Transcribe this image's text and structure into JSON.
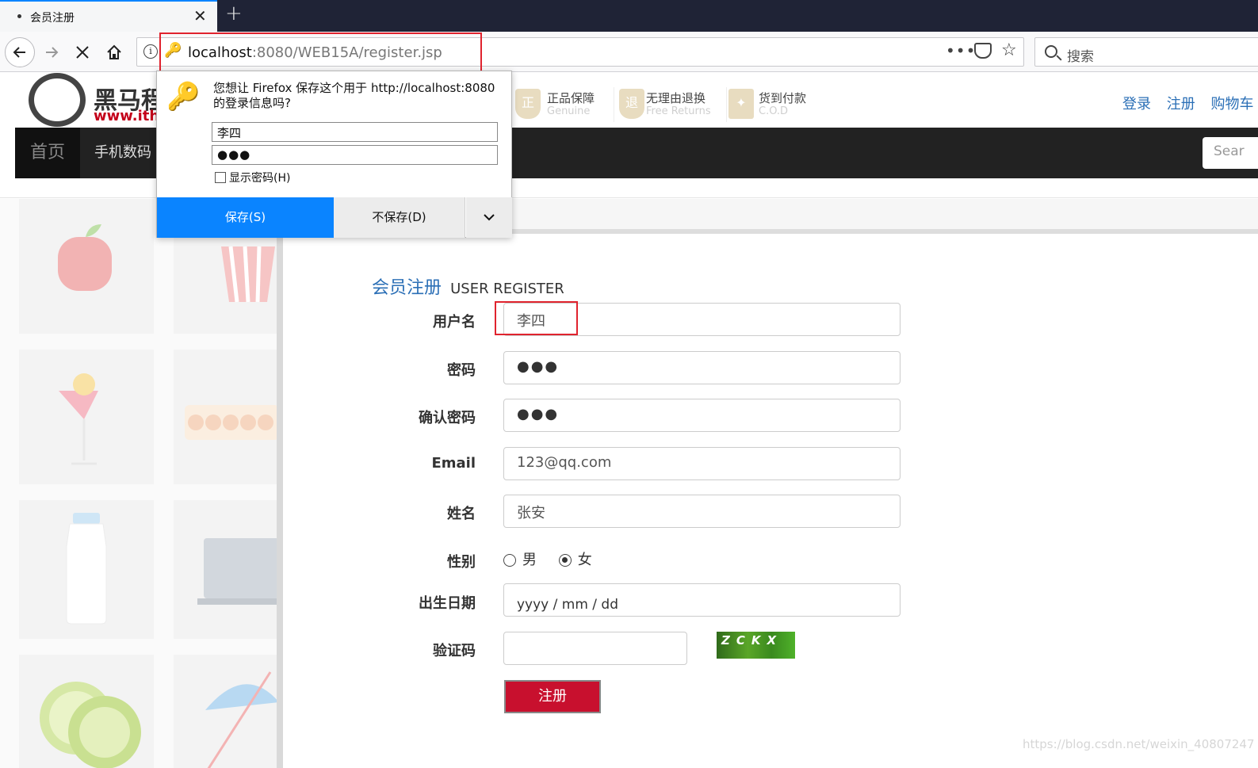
{
  "browser": {
    "tab_title": "会员注册",
    "tab_close": "✕",
    "new_tab": "+",
    "url_host": "localhost",
    "url_rest": ":8080/WEB15A/register.jsp",
    "search_placeholder": "搜索",
    "url_more": "•••"
  },
  "password_popup": {
    "message": "您想让 Firefox 保存这个用于 http://localhost:8080 的登录信息吗?",
    "username": "李四",
    "password_mask": "●●●",
    "show_password_label": "显示密码(H)",
    "save_label": "保存(S)",
    "dont_save_label": "不保存(D)",
    "menu_glyph": "⌄",
    "highlight_color": "#0a84ff"
  },
  "site": {
    "logo_name": "黑马程",
    "logo_url": "www.ithe",
    "promos": [
      {
        "title": "正品保障",
        "subtitle": "Genuine",
        "glyph": "正"
      },
      {
        "title": "无理由退换",
        "subtitle": "Free Returns",
        "glyph": "退"
      },
      {
        "title": "货到付款",
        "subtitle": "C.O.D",
        "glyph": "✦"
      }
    ],
    "top_links": [
      "登录",
      "注册",
      "购物车"
    ],
    "nav": {
      "home": "首页",
      "phone": "手机数码",
      "search_placeholder": "Sear"
    }
  },
  "form": {
    "title_zh": "会员注册",
    "title_en": "USER REGISTER",
    "fields": {
      "username": {
        "label": "用户名",
        "value": "李四"
      },
      "password": {
        "label": "密码",
        "value": "●●●"
      },
      "confirm": {
        "label": "确认密码",
        "value": "●●●"
      },
      "email": {
        "label": "Email",
        "value": "123@qq.com"
      },
      "name": {
        "label": "姓名",
        "value": "张安"
      },
      "gender": {
        "label": "性别",
        "options": [
          "男",
          "女"
        ],
        "selected": "女"
      },
      "birthday": {
        "label": "出生日期",
        "placeholder": "yyyy / mm / dd"
      },
      "captcha": {
        "label": "验证码",
        "value": "",
        "image_text": "ZCKX"
      }
    },
    "submit_label": "注册",
    "accent_color": "#c8102e"
  },
  "watermark": "https://blog.csdn.net/weixin_40807247"
}
